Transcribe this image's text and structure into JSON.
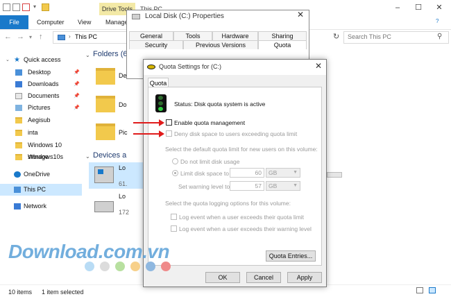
{
  "explorer": {
    "ribbon_context": "Drive Tools",
    "window_title": "This PC",
    "tabs": [
      "File",
      "Computer",
      "View",
      "Manage"
    ],
    "address": "This PC",
    "search_placeholder": "Search This PC",
    "sidebar": {
      "quick_access": "Quick access",
      "items": [
        "Desktop",
        "Downloads",
        "Documents",
        "Pictures",
        "Aegisub",
        "inta",
        "Windows 10 storage",
        "Windows10s"
      ],
      "onedrive": "OneDrive",
      "this_pc": "This PC",
      "network": "Network"
    },
    "content": {
      "folders_heading": "Folders (6",
      "folder_names": [
        "De",
        "Do",
        "Pic"
      ],
      "devices_heading": "Devices a",
      "drives": [
        {
          "name": "Lo",
          "detail": "61."
        },
        {
          "name": "Lo",
          "detail": "172"
        }
      ]
    },
    "status": {
      "items": "10 items",
      "selected": "1 item selected"
    }
  },
  "properties": {
    "title": "Local Disk (C:) Properties",
    "tabs_row1": [
      "General",
      "Tools",
      "Hardware",
      "Sharing"
    ],
    "tabs_row2": [
      "Security",
      "Previous Versions",
      "Quota"
    ]
  },
  "quota": {
    "title": "Quota Settings for  (C:)",
    "tab": "Quota",
    "status": "Status:  Disk quota system is active",
    "enable_label": "Enable quota management",
    "deny_label": "Deny disk space to users exceeding quota limit",
    "default_limit_heading": "Select the default quota limit for new users on this volume:",
    "no_limit_label": "Do not limit disk usage",
    "limit_label": "Limit disk space to",
    "limit_value": "60",
    "limit_unit": "GB",
    "warning_label": "Set warning level to",
    "warning_value": "57",
    "warning_unit": "GB",
    "logging_heading": "Select the quota logging options for this volume:",
    "log_limit_label": "Log event when a user exceeds their quota limit",
    "log_warning_label": "Log event when a user exceeds their warning level",
    "entries_button": "Quota Entries...",
    "ok_button": "OK",
    "cancel_button": "Cancel",
    "apply_button": "Apply"
  },
  "watermark": "Download.com.vn",
  "colors": {
    "file_tab": "#1979ca",
    "drive_tools": "#f3e9a6",
    "arrow": "#e01b1b",
    "selection": "#cce8ff",
    "watermark": "#5aa0d8"
  }
}
